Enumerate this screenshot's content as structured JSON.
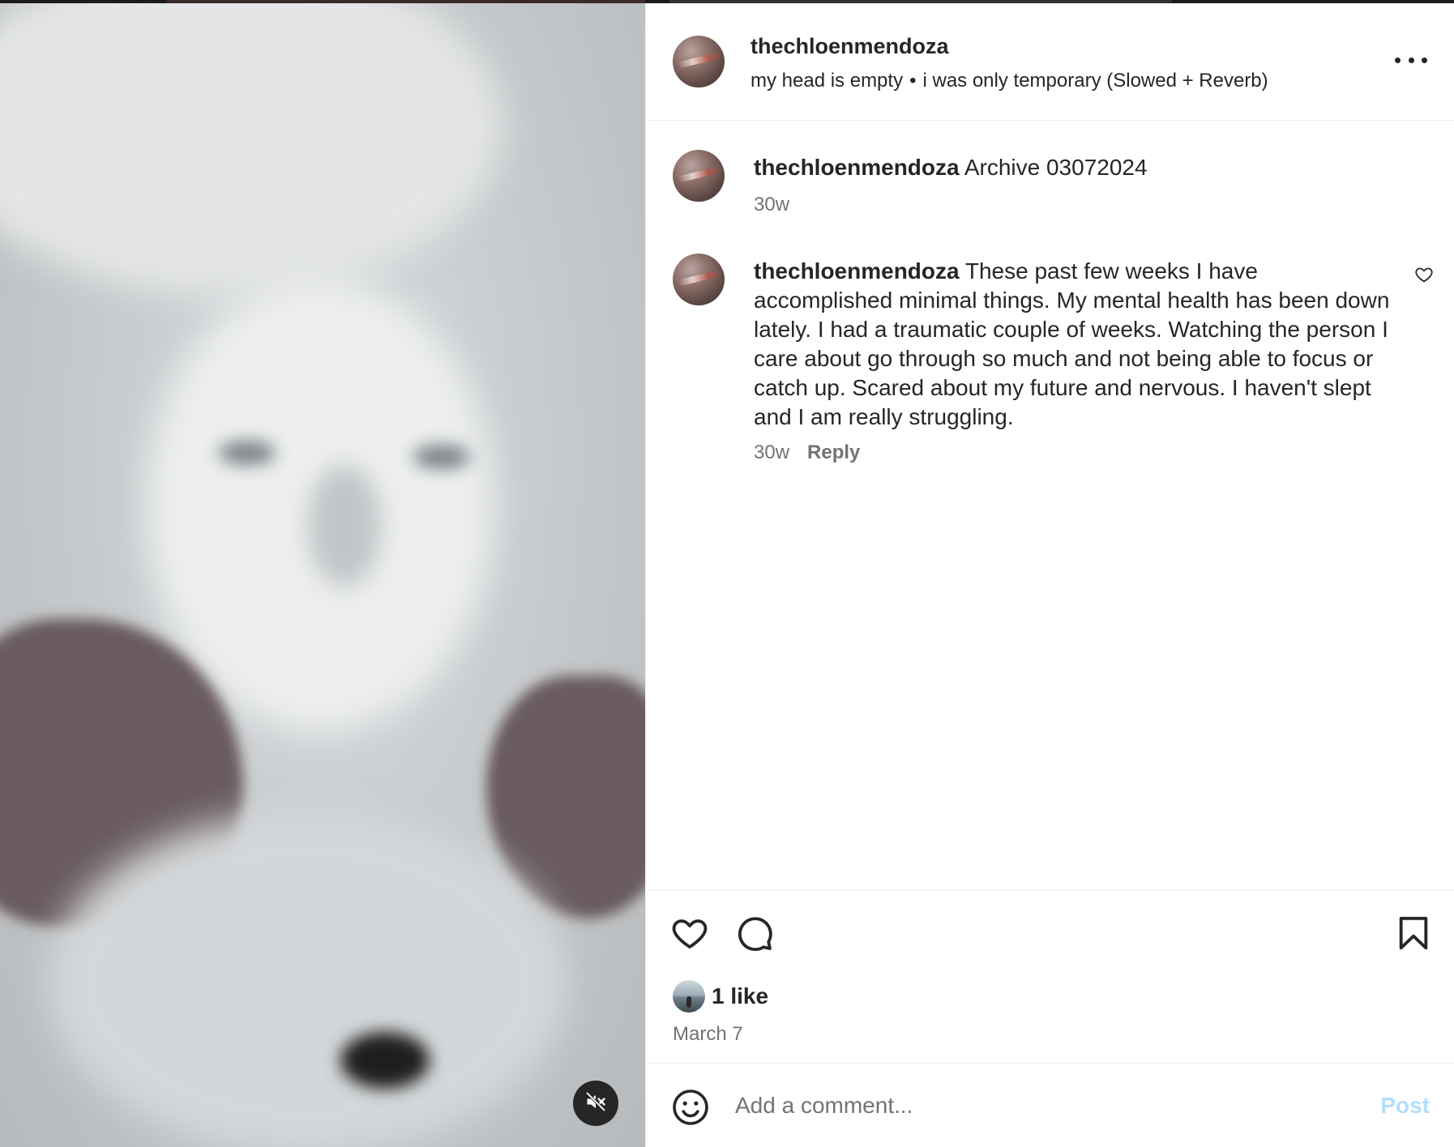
{
  "post": {
    "username": "thechloenmendoza",
    "audio": {
      "track": "my head is empty",
      "separator": "•",
      "song": "i was only temporary (Slowed + Reverb)"
    }
  },
  "comments": [
    {
      "username": "thechloenmendoza",
      "text": "Archive 03072024",
      "time": "30w"
    },
    {
      "username": "thechloenmendoza",
      "text": "These past few weeks I have accomplished minimal things. My mental health has been down lately. I had a traumatic couple of weeks. Watching the person I care about go through so much and not being able to focus or catch up. Scared about my future and nervous. I haven't slept and I am really struggling.",
      "time": "30w",
      "reply_label": "Reply"
    }
  ],
  "engagement": {
    "likes": "1 like",
    "date": "March 7"
  },
  "composer": {
    "placeholder": "Add a comment...",
    "post_label": "Post"
  },
  "colors": {
    "text": "#262626",
    "secondary": "#737373",
    "post_button_disabled": "#b2dffc",
    "divider": "#efefef"
  },
  "icons": {
    "more": "more-options-icon",
    "like": "heart-icon",
    "comment": "comment-bubble-icon",
    "save": "bookmark-icon",
    "emoji": "emoji-smile-icon",
    "mute": "speaker-muted-icon"
  }
}
